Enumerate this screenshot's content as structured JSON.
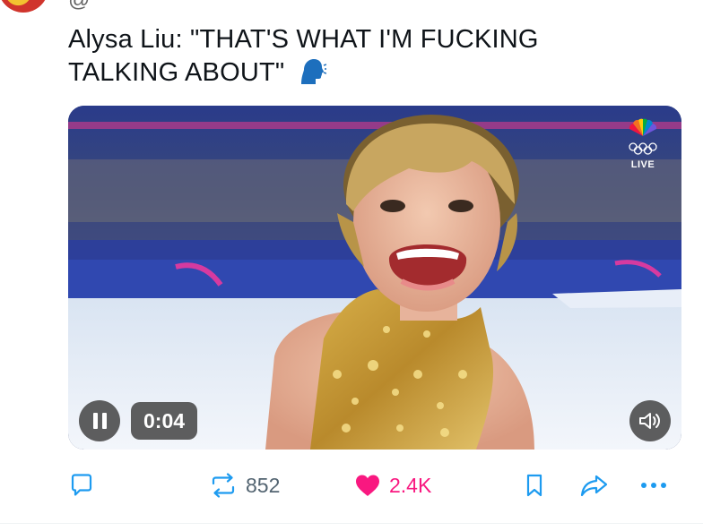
{
  "post": {
    "text": "Alysa Liu: \"THAT'S WHAT I'M FUCKING TALKING ABOUT\"",
    "emoji": "speaking-head",
    "author_handle_partial": "@ "
  },
  "video": {
    "broadcaster_badge": "LIVE",
    "elapsed_time": "0:04",
    "state": "playing",
    "controls": {
      "pause_icon": "pause-icon",
      "volume_icon": "speaker-icon"
    }
  },
  "actions": {
    "reply_count": "",
    "repost_count": "852",
    "like_count": "2.4K",
    "liked": true,
    "colors": {
      "like": "#f91880",
      "reply": "#1d9bf0",
      "neutral": "#536471",
      "action_blue": "#1d9bf0"
    }
  }
}
